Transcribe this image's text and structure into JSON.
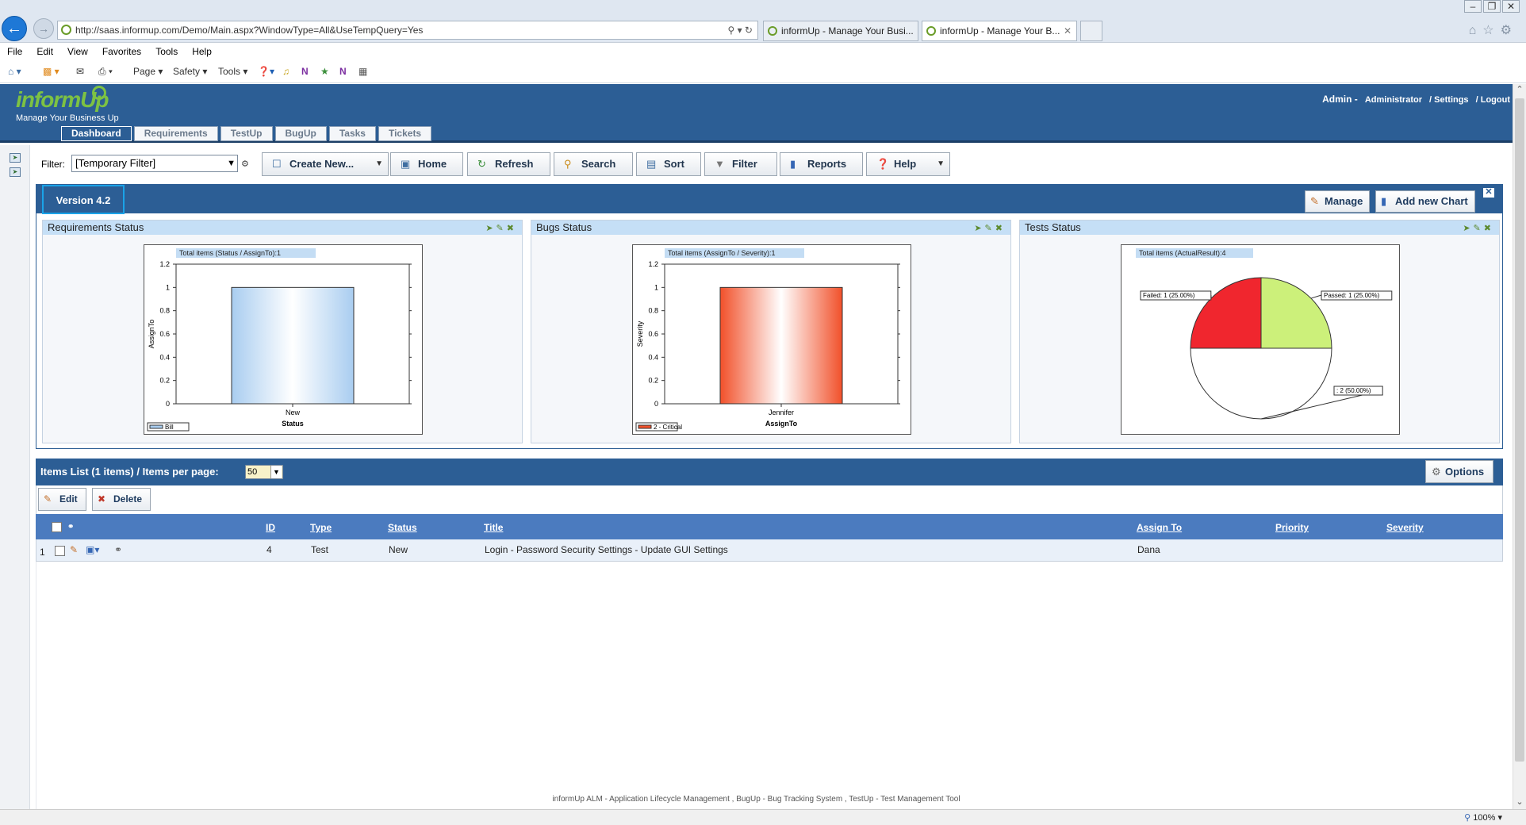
{
  "browser": {
    "url": "http://saas.informup.com/Demo/Main.aspx?WindowType=All&UseTempQuery=Yes",
    "tabs": [
      {
        "title": "informUp - Manage Your Busi..."
      },
      {
        "title": "informUp - Manage Your B..."
      }
    ],
    "menu": [
      "File",
      "Edit",
      "View",
      "Favorites",
      "Tools",
      "Help"
    ],
    "commands": [
      "Page ▾",
      "Safety ▾",
      "Tools ▾"
    ],
    "zoom": "100%"
  },
  "app": {
    "logo": "informUp",
    "tagline": "Manage Your Business Up",
    "user": {
      "name": "Admin -",
      "role": "Administrator",
      "settings": "/ Settings",
      "logout": "/ Logout"
    },
    "tabs": [
      {
        "label": "Dashboard"
      },
      {
        "label": "Requirements"
      },
      {
        "label": "TestUp"
      },
      {
        "label": "BugUp"
      },
      {
        "label": "Tasks"
      },
      {
        "label": "Tickets"
      }
    ]
  },
  "toolbar": {
    "filter_label": "Filter:",
    "filter_value": "[Temporary Filter]",
    "buttons": [
      {
        "label": "Create New..."
      },
      {
        "label": "Home"
      },
      {
        "label": "Refresh"
      },
      {
        "label": "Search"
      },
      {
        "label": "Sort"
      },
      {
        "label": "Filter"
      },
      {
        "label": "Reports"
      },
      {
        "label": "Help"
      }
    ]
  },
  "dashboard": {
    "version": "Version 4.2",
    "manage_label": "Manage",
    "add_chart_label": "Add new Chart",
    "widgets": [
      {
        "title": "Requirements Status"
      },
      {
        "title": "Bugs Status"
      },
      {
        "title": "Tests Status"
      }
    ]
  },
  "chart_data": [
    {
      "type": "bar",
      "title": "Total items (Status / AssignTo):1",
      "categories": [
        "New"
      ],
      "series": [
        {
          "name": "Bill",
          "values": [
            1
          ]
        }
      ],
      "xlabel": "Status",
      "ylabel": "AssignTo",
      "ylim": [
        0,
        1.2
      ],
      "yticks": [
        "0",
        "0.2",
        "0.4",
        "0.6",
        "0.8",
        "1",
        "1.2"
      ],
      "color": "#a9cdf0"
    },
    {
      "type": "bar",
      "title": "Total items (AssignTo / Severity):1",
      "categories": [
        "Jennifer"
      ],
      "series": [
        {
          "name": "2 - Critical",
          "values": [
            1
          ]
        }
      ],
      "xlabel": "AssignTo",
      "ylabel": "Severity",
      "ylim": [
        0,
        1.2
      ],
      "yticks": [
        "0",
        "0.2",
        "0.4",
        "0.6",
        "0.8",
        "1",
        "1.2"
      ],
      "color": "#f1502a"
    },
    {
      "type": "pie",
      "title": "Total items (ActualResult):4",
      "slices": [
        {
          "label": "Passed: 1 (25.00%)",
          "value": 25,
          "color": "#ccf07a"
        },
        {
          "label": ": 2 (50.00%)",
          "value": 50,
          "color": "#ffffff"
        },
        {
          "label": "Failed: 1 (25.00%)",
          "value": 25,
          "color": "#f0262e"
        }
      ]
    }
  ],
  "items": {
    "title": "Items List  (1 items) / Items per page:",
    "per_page": "50",
    "options_label": "Options",
    "edit_label": "Edit",
    "delete_label": "Delete",
    "columns": [
      "ID",
      "Type",
      "Status",
      "Title",
      "Assign To",
      "Priority",
      "Severity"
    ],
    "rows": [
      {
        "num": "1",
        "id": "4",
        "type": "Test",
        "status": "New",
        "title": "Login - Password Security Settings - Update GUI Settings",
        "assign_to": "Dana",
        "priority": "",
        "severity": ""
      }
    ]
  },
  "footer": "informUp ALM - Application Lifecycle Management , BugUp - Bug Tracking System , TestUp - Test Management Tool"
}
